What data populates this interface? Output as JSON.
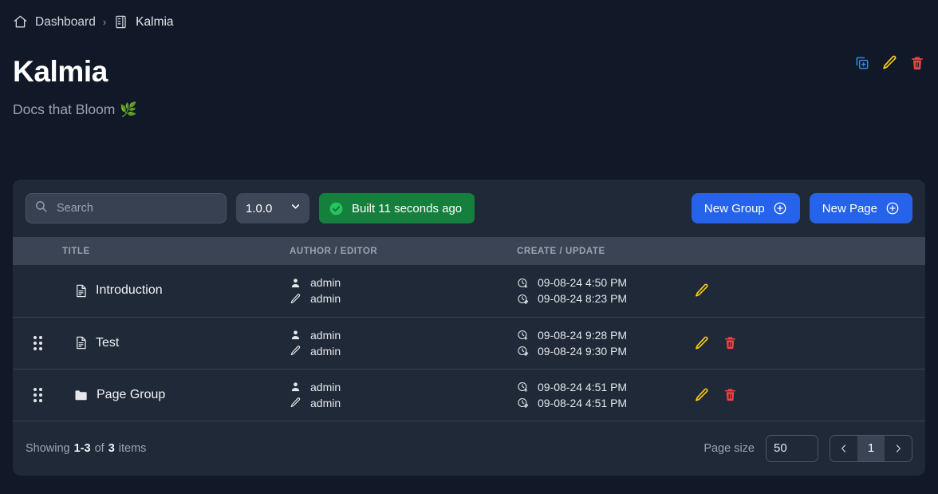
{
  "breadcrumb": {
    "home_icon": "home-icon",
    "items": [
      {
        "label": "Dashboard",
        "icon": "home-icon"
      },
      {
        "label": "Kalmia",
        "icon": "notebook-icon"
      }
    ],
    "separator": "›"
  },
  "header_actions": [
    {
      "name": "duplicate-button",
      "icon": "copy-plus-icon",
      "color": "#3b82f6"
    },
    {
      "name": "edit-button",
      "icon": "pencil-icon",
      "color": "#facc15"
    },
    {
      "name": "delete-button",
      "icon": "trash-icon",
      "color": "#ef4444"
    }
  ],
  "header": {
    "title": "Kalmia",
    "subtitle": "Docs that Bloom",
    "subtitle_emoji": "🌿"
  },
  "toolbar": {
    "search": {
      "value": "",
      "placeholder": "Search",
      "icon": "search-icon"
    },
    "version": {
      "selected": "1.0.0",
      "options": [
        "1.0.0"
      ],
      "icon": "chevron-down-icon"
    },
    "build_status": {
      "label": "Built 11 seconds ago",
      "icon": "check-circle-icon",
      "color": "#15803d"
    },
    "new_group_label": "New Group",
    "new_group_icon": "plus-circle-icon",
    "new_page_label": "New Page",
    "new_page_icon": "plus-circle-icon",
    "accent_color": "#2563eb"
  },
  "table": {
    "columns": [
      "",
      "TITLE",
      "AUTHOR / EDITOR",
      "CREATE / UPDATE",
      ""
    ],
    "rows": [
      {
        "draggable": false,
        "type_icon": "document-icon",
        "title": "Introduction",
        "author": "admin",
        "editor": "admin",
        "created": "09-08-24 4:50 PM",
        "updated": "09-08-24 8:23 PM",
        "can_edit": true,
        "can_delete": false
      },
      {
        "draggable": true,
        "type_icon": "document-icon",
        "title": "Test",
        "author": "admin",
        "editor": "admin",
        "created": "09-08-24 9:28 PM",
        "updated": "09-08-24 9:30 PM",
        "can_edit": true,
        "can_delete": true
      },
      {
        "draggable": true,
        "type_icon": "folder-icon",
        "title": "Page Group",
        "author": "admin",
        "editor": "admin",
        "created": "09-08-24 4:51 PM",
        "updated": "09-08-24 4:51 PM",
        "can_edit": true,
        "can_delete": true
      }
    ]
  },
  "footer": {
    "showing_prefix": "Showing",
    "range": "1-3",
    "of": "of",
    "total": "3",
    "items_suffix": "items",
    "page_size_label": "Page size",
    "page_size": {
      "selected": "50",
      "options": [
        "50"
      ]
    },
    "pagination": {
      "prev_icon": "chevron-left-icon",
      "next_icon": "chevron-right-icon",
      "current_page": "1"
    }
  }
}
